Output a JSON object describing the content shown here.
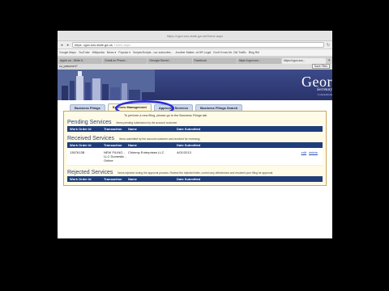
{
  "browser": {
    "title": "https://cgov.sos.state.ga.us/Home.aspx",
    "url_domain": "https",
    "url": "cgov.sos.state.ga.us",
    "url_hint": "Home.aspx",
    "bookmarks": [
      "Google Maps",
      "YouTube",
      "Wikipedia",
      "News ▾",
      "Popular ▾",
      "Scripts/Scripts - our subscribe...",
      "Another Matter- at HR Legal",
      "Don't Know Mr. Old Traffic",
      "Blog Rel"
    ],
    "tabs": [
      "Apple.ca - Write it...",
      "Gmail.on Phone...",
      "Georgia Secret...",
      "Facebook",
      "https://cgov.sos...",
      "https://cgov.sos..."
    ],
    "new_tab": "+"
  },
  "session": {
    "left_text": "cu_password?",
    "right_button": "Save Files"
  },
  "banner": {
    "title": "Geor",
    "subtitle": "Secretary",
    "subtitle2": "Corporations"
  },
  "portal_tabs": [
    "Business Filings",
    "Services Management",
    "Approved Services",
    "Business Filings Search"
  ],
  "notice": "To perform a new filing, please go to the Business Filings tab.",
  "columns": [
    "Work Order Id",
    "Transaction",
    "Name",
    "Date Submitted"
  ],
  "sections": {
    "pending": {
      "title": "Pending Services",
      "desc": "Items pending submission by the account customer."
    },
    "received": {
      "title": "Received Services",
      "desc": "Items submitted by the account customer and received for reviewing.",
      "rows": [
        {
          "work_order": "1367613B",
          "transaction": "NEW FILING - LLC Domestic - Online",
          "name": "Chimmy Enterprises LLC",
          "date": "4/01/2013",
          "edit": "edit",
          "delete": "delete"
        }
      ]
    },
    "rejected": {
      "title": "Rejected Services",
      "desc": "Items rejected during the approval process. Review the rejected letter, correct any deficiencies and resubmit your filing for approval."
    }
  },
  "colors": {
    "header_bar": "#1f3d7a",
    "section_title": "#2c3f85",
    "highlight_ring": "#2c2fd6"
  }
}
